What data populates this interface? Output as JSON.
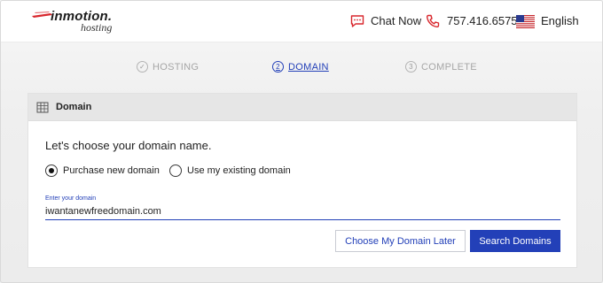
{
  "header": {
    "logo_main": "inmotion.",
    "logo_sub": "hosting",
    "chat_label": "Chat Now",
    "phone_label": "757.416.6575",
    "language_label": "English"
  },
  "steps": [
    {
      "label": "HOSTING",
      "marker": "✓",
      "state": "done"
    },
    {
      "label": "DOMAIN",
      "marker": "2",
      "state": "active"
    },
    {
      "label": "COMPLETE",
      "marker": "3",
      "state": "pending"
    }
  ],
  "card": {
    "title": "Domain",
    "question": "Let's choose your domain name.",
    "options": [
      {
        "label": "Purchase new domain",
        "selected": true
      },
      {
        "label": "Use my existing domain",
        "selected": false
      }
    ],
    "field_label": "Enter your domain",
    "field_value": "iwantanewfreedomain.com",
    "later_button": "Choose My Domain Later",
    "search_button": "Search Domains"
  },
  "colors": {
    "accent": "#2340b8",
    "brand_red": "#d8272d",
    "panel_header": "#e6e6e6"
  },
  "icons": {
    "chat": "chat-icon",
    "phone": "phone-icon",
    "flag": "us-flag-icon",
    "building": "building-icon"
  }
}
